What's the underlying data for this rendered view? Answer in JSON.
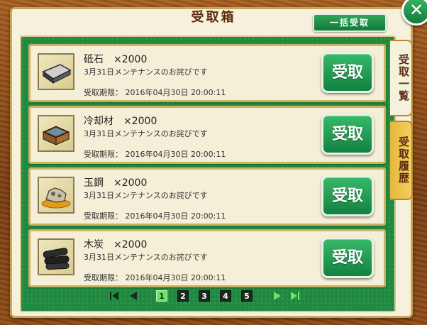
{
  "dialog": {
    "title": "受取箱",
    "bulk_receive_label": "一括受取",
    "close_label": "✕"
  },
  "tabs": [
    {
      "label": "受取一覧",
      "active": true
    },
    {
      "label": "受取履歴",
      "active": false
    }
  ],
  "items": [
    {
      "name": "砥石　×2000",
      "icon": "whetstone-icon",
      "description": "3月31日メンテナンスのお詫びです",
      "expiry": "受取期限：  2016年04月30日 20:00:11",
      "button_label": "受取"
    },
    {
      "name": "冷却材　×2000",
      "icon": "coolant-icon",
      "description": "3月31日メンテナンスのお詫びです",
      "expiry": "受取期限：  2016年04月30日 20:00:11",
      "button_label": "受取"
    },
    {
      "name": "玉鋼　×2000",
      "icon": "tamahagane-icon",
      "description": "3月31日メンテナンスのお詫びです",
      "expiry": "受取期限：  2016年04月30日 20:00:11",
      "button_label": "受取"
    },
    {
      "name": "木炭　×2000",
      "icon": "charcoal-icon",
      "description": "3月31日メンテナンスのお詫びです",
      "expiry": "受取期限：  2016年04月30日 20:00:11",
      "button_label": "受取"
    }
  ],
  "pagination": {
    "pages": [
      "1",
      "2",
      "3",
      "4",
      "5"
    ],
    "current": "1"
  },
  "colors": {
    "panel": "#1f8a3f",
    "button": "#138040",
    "wood": "#8f4c17",
    "tab_inactive": "#f3cf5d"
  }
}
